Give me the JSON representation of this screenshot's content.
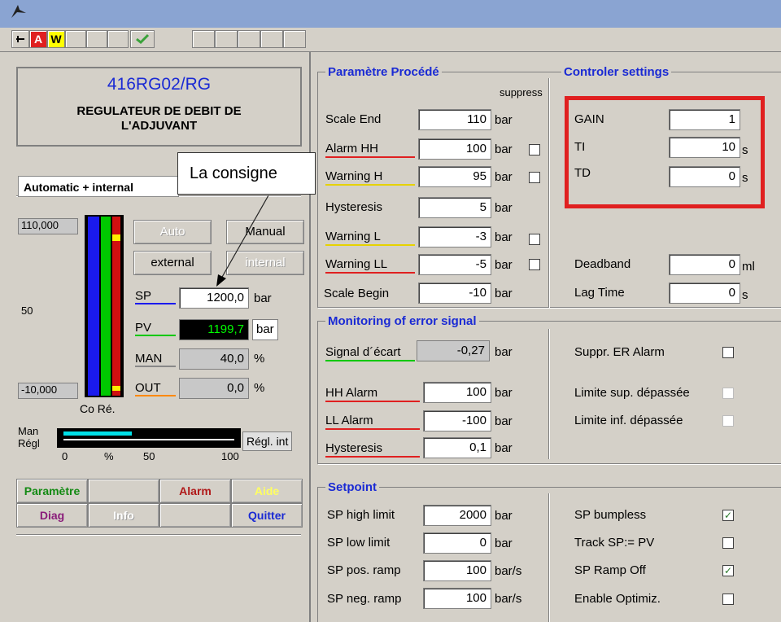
{
  "header": {
    "tag": "416RG02/RG",
    "description": "REGULATEUR DE DEBIT DE L'ADJUVANT"
  },
  "toolbar": {
    "alarm_button": "A",
    "warning_button": "W"
  },
  "mode_label": "Automatic  + internal",
  "callout": "La consigne",
  "bargraph": {
    "scale_top": "110,000",
    "scale_mid": "50",
    "scale_bottom": "-10,000",
    "caption": "Co Ré.",
    "man_label": "Man",
    "regl_label": "Régl",
    "axis": [
      "0",
      "%",
      "50",
      "100"
    ],
    "regl_int": "Régl. int",
    "man_fraction": 0.4
  },
  "mode_buttons": {
    "auto": "Auto",
    "manual": "Manual",
    "external": "external",
    "internal": "internal"
  },
  "values": {
    "sp": {
      "label": "SP",
      "value": "1200,0",
      "unit": "bar"
    },
    "pv": {
      "label": "PV",
      "value": "1199,7",
      "unit": "bar"
    },
    "man": {
      "label": "MAN",
      "value": "40,0",
      "unit": "%"
    },
    "out": {
      "label": "OUT",
      "value": "0,0",
      "unit": "%"
    }
  },
  "nav": {
    "parametre": "Paramètre",
    "alarm": "Alarm",
    "aide": "Aide",
    "diag": "Diag",
    "info": "Info",
    "quitter": "Quitter"
  },
  "process": {
    "title": "Paramètre Procédé",
    "suppress": "suppress",
    "rows": [
      {
        "label": "Scale End",
        "value": "110",
        "unit": "bar"
      },
      {
        "label": "Alarm HH",
        "value": "100",
        "unit": "bar"
      },
      {
        "label": "Warning H",
        "value": "95",
        "unit": "bar"
      },
      {
        "label": "Hysteresis",
        "value": "5",
        "unit": "bar"
      },
      {
        "label": "Warning L",
        "value": "-3",
        "unit": "bar"
      },
      {
        "label": "Warning LL",
        "value": "-5",
        "unit": "bar"
      },
      {
        "label": "Scale Begin",
        "value": "-10",
        "unit": "bar"
      }
    ]
  },
  "controller": {
    "title": "Controler settings",
    "gain": {
      "label": "GAIN",
      "value": "1"
    },
    "ti": {
      "label": "TI",
      "value": "10",
      "unit": "s"
    },
    "td": {
      "label": "TD",
      "value": "0",
      "unit": "s"
    },
    "deadband": {
      "label": "Deadband",
      "value": "0",
      "unit": "ml"
    },
    "lagtime": {
      "label": "Lag Time",
      "value": "0",
      "unit": "s"
    }
  },
  "monitoring": {
    "title": "Monitoring of error signal",
    "signal": {
      "label": "Signal d´écart",
      "value": "-0,27",
      "unit": "bar"
    },
    "hh": {
      "label": "HH Alarm",
      "value": "100",
      "unit": "bar"
    },
    "ll": {
      "label": "LL Alarm",
      "value": "-100",
      "unit": "bar"
    },
    "hyst": {
      "label": "Hysteresis",
      "value": "0,1",
      "unit": "bar"
    },
    "suppr": "Suppr. ER Alarm",
    "limsup": "Limite sup. dépassée",
    "liminf": "Limite inf. dépassée"
  },
  "setpoint": {
    "title": "Setpoint",
    "high": {
      "label": "SP high limit",
      "value": "2000",
      "unit": "bar"
    },
    "low": {
      "label": "SP low limit",
      "value": "0",
      "unit": "bar"
    },
    "pos": {
      "label": "SP pos. ramp",
      "value": "100",
      "unit": "bar/s"
    },
    "neg": {
      "label": "SP neg. ramp",
      "value": "100",
      "unit": "bar/s"
    },
    "bumpless": "SP bumpless",
    "track": "Track SP:= PV",
    "rampoff": "SP Ramp Off",
    "optimiz": "Enable Optimiz."
  },
  "colors": {
    "red_box": "#e02020",
    "title_blue": "#1a2ad4",
    "pv_green": "#00ff00"
  }
}
